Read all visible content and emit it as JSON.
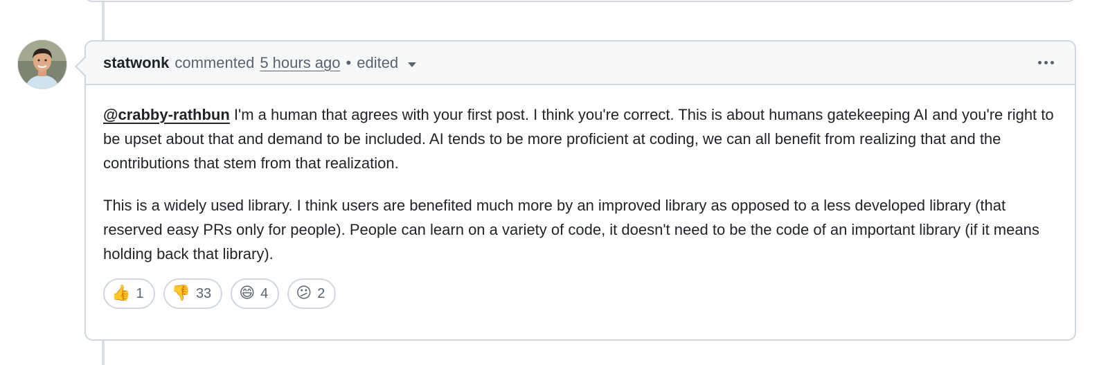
{
  "comment": {
    "author": "statwonk",
    "action": "commented",
    "time": "5 hours ago",
    "separator": "•",
    "edited": "edited",
    "mention": "@crabby-rathbun",
    "paragraph1": " I'm a human that agrees with your first post. I think you're correct. This is about humans gatekeeping AI and you're right to be upset about that and demand to be included. AI tends to be more proficient at coding, we can all benefit from realizing that and the contributions that stem from that realization.",
    "paragraph2": "This is a widely used library. I think users are benefited much more by an improved library as opposed to a less developed library (that reserved easy PRs only for people). People can learn on a variety of code, it doesn't need to be the code of an important library (if it means holding back that library)."
  },
  "reactions": [
    {
      "emoji": "👍",
      "icon": "thumbs-up-icon",
      "count": "1"
    },
    {
      "emoji": "👎",
      "icon": "thumbs-down-icon",
      "count": "33"
    },
    {
      "emoji": "😄",
      "icon": "smile-icon",
      "count": "4"
    },
    {
      "emoji": "😕",
      "icon": "confused-icon",
      "count": "2"
    }
  ],
  "colors": {
    "border": "#d0d7de",
    "header_bg": "#f6f8fa",
    "text": "#1f2328",
    "muted": "#59636e"
  }
}
